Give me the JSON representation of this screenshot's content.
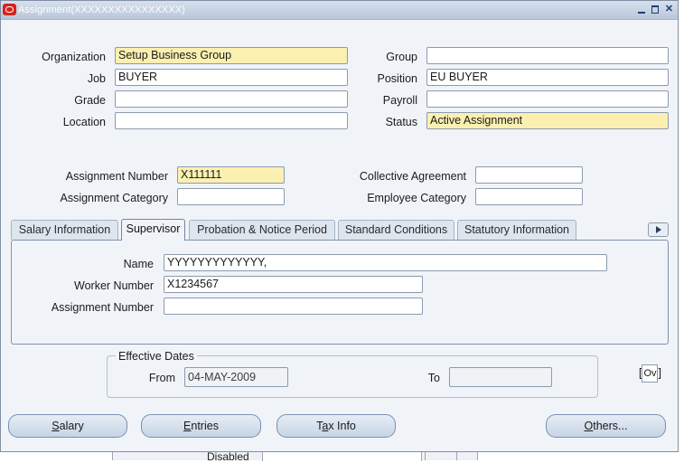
{
  "window": {
    "title": "Assignment(XXXXXXXXXXXXXXXX)",
    "icon": "oracle-app-icon"
  },
  "top_fields": {
    "organization": {
      "label": "Organization",
      "value": "Setup Business Group"
    },
    "job": {
      "label": "Job",
      "value": "BUYER"
    },
    "grade": {
      "label": "Grade",
      "value": ""
    },
    "location": {
      "label": "Location",
      "value": ""
    },
    "group": {
      "label": "Group",
      "value": ""
    },
    "position": {
      "label": "Position",
      "value": "EU BUYER"
    },
    "payroll": {
      "label": "Payroll",
      "value": ""
    },
    "status": {
      "label": "Status",
      "value": "Active Assignment"
    }
  },
  "assignment_fields": {
    "assignment_number": {
      "label": "Assignment Number",
      "value": "X111111"
    },
    "assignment_category": {
      "label": "Assignment Category",
      "value": ""
    },
    "collective_agreement": {
      "label": "Collective Agreement",
      "value": ""
    },
    "employee_category": {
      "label": "Employee Category",
      "value": ""
    }
  },
  "tabs": [
    {
      "label": "Salary Information",
      "active": false
    },
    {
      "label": "Supervisor",
      "active": true
    },
    {
      "label": "Probation & Notice Period",
      "active": false
    },
    {
      "label": "Standard Conditions",
      "active": false
    },
    {
      "label": "Statutory Information",
      "active": false
    }
  ],
  "supervisor": {
    "name": {
      "label": "Name",
      "value": "YYYYYYYYYYYYY,"
    },
    "worker_number": {
      "label": "Worker Number",
      "value": "X1234567"
    },
    "assignment_number": {
      "label": "Assignment Number",
      "value": ""
    }
  },
  "effective_dates": {
    "title": "Effective Dates",
    "from_label": "From",
    "from_value": "04-MAY-2009",
    "to_label": "To",
    "to_value": ""
  },
  "ov_indicator": {
    "left": "[",
    "box": "Ov",
    "right": "]"
  },
  "buttons": {
    "salary": {
      "first": "S",
      "rest": "alary"
    },
    "entries": {
      "first": "E",
      "rest": "ntries"
    },
    "tax_info": {
      "pre": "T",
      "first": "a",
      "rest": "x Info"
    },
    "others": {
      "first": "O",
      "rest": "thers..."
    }
  },
  "background_window": {
    "label": "Disabled"
  },
  "colors": {
    "required_field": "#fcf0b1",
    "window_bg": "#f0f4f9",
    "title_bar": "#c7d4e4",
    "oracle_red": "#d7231b"
  }
}
